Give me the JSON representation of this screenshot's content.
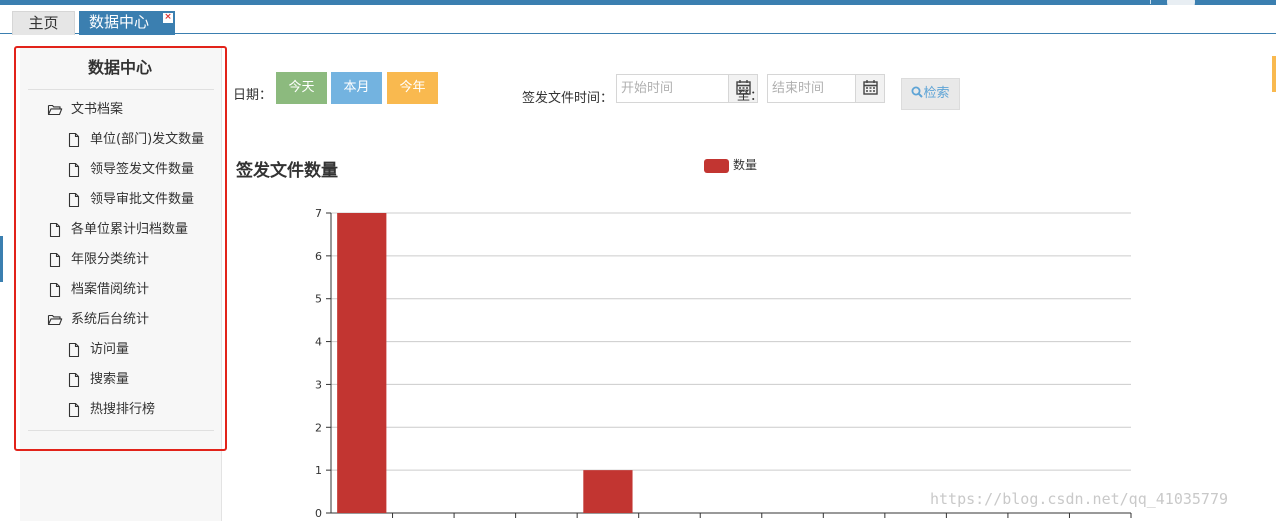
{
  "tabs": [
    {
      "label": "主页"
    },
    {
      "label": "数据中心",
      "close": "×"
    }
  ],
  "sidebar": {
    "title": "数据中心",
    "items": [
      {
        "label": "文书档案",
        "icon": "folder-open-icon",
        "level": 0
      },
      {
        "label": "单位(部门)发文数量",
        "icon": "file-icon",
        "level": 1
      },
      {
        "label": "领导签发文件数量",
        "icon": "file-icon",
        "level": 1
      },
      {
        "label": "领导审批文件数量",
        "icon": "file-icon",
        "level": 1
      },
      {
        "label": "各单位累计归档数量",
        "icon": "file-icon",
        "level": 0
      },
      {
        "label": "年限分类统计",
        "icon": "file-icon",
        "level": 0
      },
      {
        "label": "档案借阅统计",
        "icon": "file-icon",
        "level": 0
      },
      {
        "label": "系统后台统计",
        "icon": "folder-open-icon",
        "level": 0
      },
      {
        "label": "访问量",
        "icon": "file-icon",
        "level": 1
      },
      {
        "label": "搜索量",
        "icon": "file-icon",
        "level": 1
      },
      {
        "label": "热搜排行榜",
        "icon": "file-icon",
        "level": 1
      }
    ]
  },
  "filters": {
    "date_label": "日期：",
    "today": "今天",
    "this_month": "本月",
    "this_year": "今年",
    "sign_time_label": "签发文件时间：",
    "start_placeholder": "开始时间",
    "to_label": "至：",
    "end_placeholder": "结束时间",
    "search_label": "检索"
  },
  "colors": {
    "brand": "#3b7fb0",
    "today": "#8cba7e",
    "month": "#73b3e0",
    "year": "#f9b94f",
    "bar": "#c23531",
    "highlight_frame": "#e2231a"
  },
  "chart_data": {
    "type": "bar",
    "title": "签发文件数量",
    "legend": [
      "数量"
    ],
    "categories": [
      "",
      "",
      "",
      "",
      "",
      "",
      "",
      "",
      "",
      "",
      "",
      "",
      ""
    ],
    "series": [
      {
        "name": "数量",
        "values": [
          7,
          0,
          0,
          0,
          1,
          0,
          0,
          0,
          0,
          0,
          0,
          0,
          0
        ]
      }
    ],
    "ylim": [
      0,
      7
    ],
    "yticks": [
      0,
      1,
      2,
      3,
      4,
      5,
      6,
      7
    ],
    "grid": true,
    "legend_position": "top-center"
  },
  "watermark": "https://blog.csdn.net/qq_41035779"
}
